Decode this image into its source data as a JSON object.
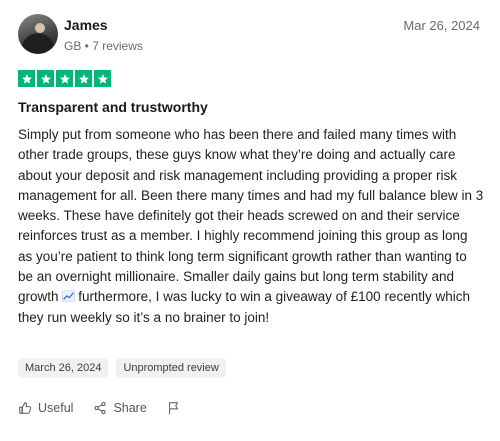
{
  "review": {
    "reviewer": {
      "name": "James",
      "meta": "GB • 7 reviews",
      "avatar": "avatar-photo"
    },
    "date_top": "Mar 26, 2024",
    "rating": 5,
    "star_color": "#00b67a",
    "title": "Transparent and trustworthy",
    "body": "Simply put from someone who has been there and failed many times with other trade groups, these guys know what they’re doing and actually care about your deposit and risk management including providing a proper risk management for all. Been there many times and had my full balance blew in 3 weeks. These have definitely got their heads screwed on and their service reinforces trust as a member. I highly recommend joining this group as long as you’re patient to think long term significant growth rather than wanting to be an overnight millionaire. Smaller daily gains but long term stability and growth",
    "body_end_icon": "chart-increasing-icon",
    "body_tail": "furthermore, I was lucky to win a giveaway of £100 recently which they run weekly so it’s a no brainer to join!",
    "tags": {
      "date": "March 26, 2024",
      "unprompted": "Unprompted review"
    },
    "actions": {
      "useful": "Useful",
      "share": "Share",
      "report_icon": "flag-icon"
    }
  }
}
